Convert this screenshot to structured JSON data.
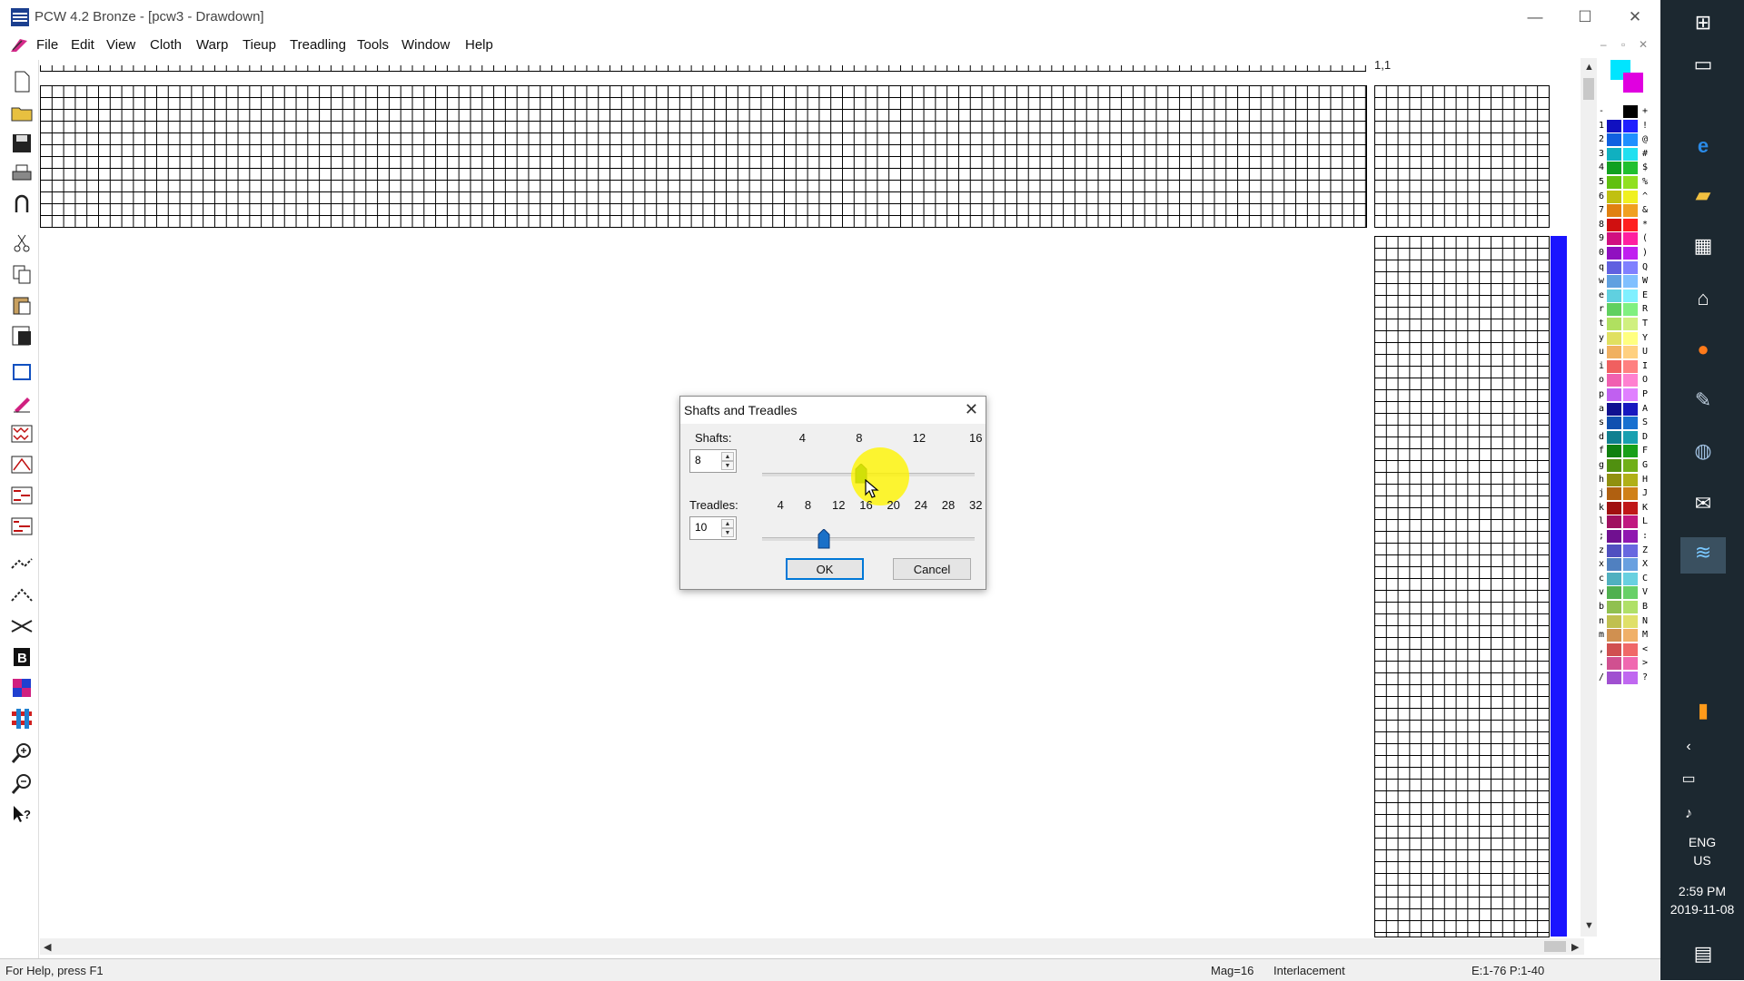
{
  "window": {
    "title": "PCW 4.2 Bronze - [pcw3 - Drawdown]",
    "minimize": "—",
    "maximize": "☐",
    "close": "✕"
  },
  "menu": [
    "File",
    "Edit",
    "View",
    "Cloth",
    "Warp",
    "Tieup",
    "Treadling",
    "Tools",
    "Window",
    "Help"
  ],
  "drawdown": {
    "coord_label": "1,1",
    "accent_color": "#1a14ff"
  },
  "palette": {
    "current_fg": "#00e5ff",
    "current_bg": "#e000e0",
    "rows": [
      {
        "left": "-",
        "right": "+",
        "c1": "#ffffff",
        "c2": "#000000"
      },
      {
        "left": "1",
        "right": "!",
        "c1": "#1010c0",
        "c2": "#2020ff"
      },
      {
        "left": "2",
        "right": "@",
        "c1": "#1060e0",
        "c2": "#2090ff"
      },
      {
        "left": "3",
        "right": "#",
        "c1": "#10b0c0",
        "c2": "#20e0f0"
      },
      {
        "left": "4",
        "right": "$",
        "c1": "#10a020",
        "c2": "#20c030"
      },
      {
        "left": "5",
        "right": "%",
        "c1": "#60c010",
        "c2": "#90e020"
      },
      {
        "left": "6",
        "right": "^",
        "c1": "#c0c010",
        "c2": "#f0f020"
      },
      {
        "left": "7",
        "right": "&",
        "c1": "#e08010",
        "c2": "#f0a020"
      },
      {
        "left": "8",
        "right": "*",
        "c1": "#d01010",
        "c2": "#ff2020"
      },
      {
        "left": "9",
        "right": "(",
        "c1": "#d01080",
        "c2": "#ff20a0"
      },
      {
        "left": "0",
        "right": ")",
        "c1": "#9010c0",
        "c2": "#c020f0"
      },
      {
        "left": "q",
        "right": "Q",
        "c1": "#6060e0",
        "c2": "#8080ff"
      },
      {
        "left": "w",
        "right": "W",
        "c1": "#60a0e0",
        "c2": "#80c0ff"
      },
      {
        "left": "e",
        "right": "E",
        "c1": "#60d0e0",
        "c2": "#80f0ff"
      },
      {
        "left": "r",
        "right": "R",
        "c1": "#60d060",
        "c2": "#80f080"
      },
      {
        "left": "t",
        "right": "T",
        "c1": "#b0e060",
        "c2": "#d0f080"
      },
      {
        "left": "y",
        "right": "Y",
        "c1": "#e0e060",
        "c2": "#ffff80"
      },
      {
        "left": "u",
        "right": "U",
        "c1": "#f0b060",
        "c2": "#ffd080"
      },
      {
        "left": "i",
        "right": "I",
        "c1": "#f06060",
        "c2": "#ff8080"
      },
      {
        "left": "o",
        "right": "O",
        "c1": "#f060b0",
        "c2": "#ff80d0"
      },
      {
        "left": "p",
        "right": "P",
        "c1": "#c060f0",
        "c2": "#e080ff"
      },
      {
        "left": "a",
        "right": "A",
        "c1": "#101090",
        "c2": "#1818c0"
      },
      {
        "left": "s",
        "right": "S",
        "c1": "#1050b0",
        "c2": "#1870d0"
      },
      {
        "left": "d",
        "right": "D",
        "c1": "#108090",
        "c2": "#18a0b0"
      },
      {
        "left": "f",
        "right": "F",
        "c1": "#108010",
        "c2": "#18a018"
      },
      {
        "left": "g",
        "right": "G",
        "c1": "#509010",
        "c2": "#70b018"
      },
      {
        "left": "h",
        "right": "H",
        "c1": "#909010",
        "c2": "#b0b018"
      },
      {
        "left": "j",
        "right": "J",
        "c1": "#b06010",
        "c2": "#d08018"
      },
      {
        "left": "k",
        "right": "K",
        "c1": "#a01010",
        "c2": "#c01818"
      },
      {
        "left": "l",
        "right": "L",
        "c1": "#a01060",
        "c2": "#c01880"
      },
      {
        "left": ";",
        "right": ":",
        "c1": "#701090",
        "c2": "#9018b0"
      },
      {
        "left": "z",
        "right": "Z",
        "c1": "#5050c0",
        "c2": "#6868e0"
      },
      {
        "left": "x",
        "right": "X",
        "c1": "#5080c0",
        "c2": "#68a0e0"
      },
      {
        "left": "c",
        "right": "C",
        "c1": "#50b0c0",
        "c2": "#68d0e0"
      },
      {
        "left": "v",
        "right": "V",
        "c1": "#50b050",
        "c2": "#68d068"
      },
      {
        "left": "b",
        "right": "B",
        "c1": "#90c050",
        "c2": "#b0e068"
      },
      {
        "left": "n",
        "right": "N",
        "c1": "#c0c050",
        "c2": "#e0e068"
      },
      {
        "left": "m",
        "right": "M",
        "c1": "#d09050",
        "c2": "#f0b068"
      },
      {
        "left": ",",
        "right": "<",
        "c1": "#d05050",
        "c2": "#f06868"
      },
      {
        "left": ".",
        "right": ">",
        "c1": "#d05090",
        "c2": "#f068b0"
      },
      {
        "left": "/",
        "right": "?",
        "c1": "#a050d0",
        "c2": "#c068f0"
      }
    ]
  },
  "status": {
    "help": "For Help, press F1",
    "mag": "Mag=16",
    "mode": "Interlacement",
    "pos": "E:1-76 P:1-40"
  },
  "taskbar": {
    "lang1": "ENG",
    "lang2": "US",
    "time": "2:59 PM",
    "date": "2019-11-08",
    "icons": [
      "windows-icon",
      "task-view-icon",
      "edge-icon",
      "file-explorer-icon",
      "store-icon",
      "home-icon",
      "firefox-icon",
      "app-icon",
      "app-icon",
      "mail-icon",
      "pcw-icon"
    ]
  },
  "dialog": {
    "title": "Shafts and Treadles",
    "close": "✕",
    "shafts": {
      "label": "Shafts:",
      "value": "8",
      "ticks": [
        "4",
        "8",
        "12",
        "16"
      ],
      "slider_value": 8,
      "slider_min": 1,
      "slider_max": 16,
      "thumb_color": "#1a8a2a"
    },
    "treadles": {
      "label": "Treadles:",
      "value": "10",
      "ticks": [
        "4",
        "8",
        "12",
        "16",
        "20",
        "24",
        "28",
        "32"
      ],
      "slider_value": 10,
      "slider_min": 1,
      "slider_max": 32,
      "thumb_color": "#1a70c8"
    },
    "ok": "OK",
    "cancel": "Cancel"
  }
}
